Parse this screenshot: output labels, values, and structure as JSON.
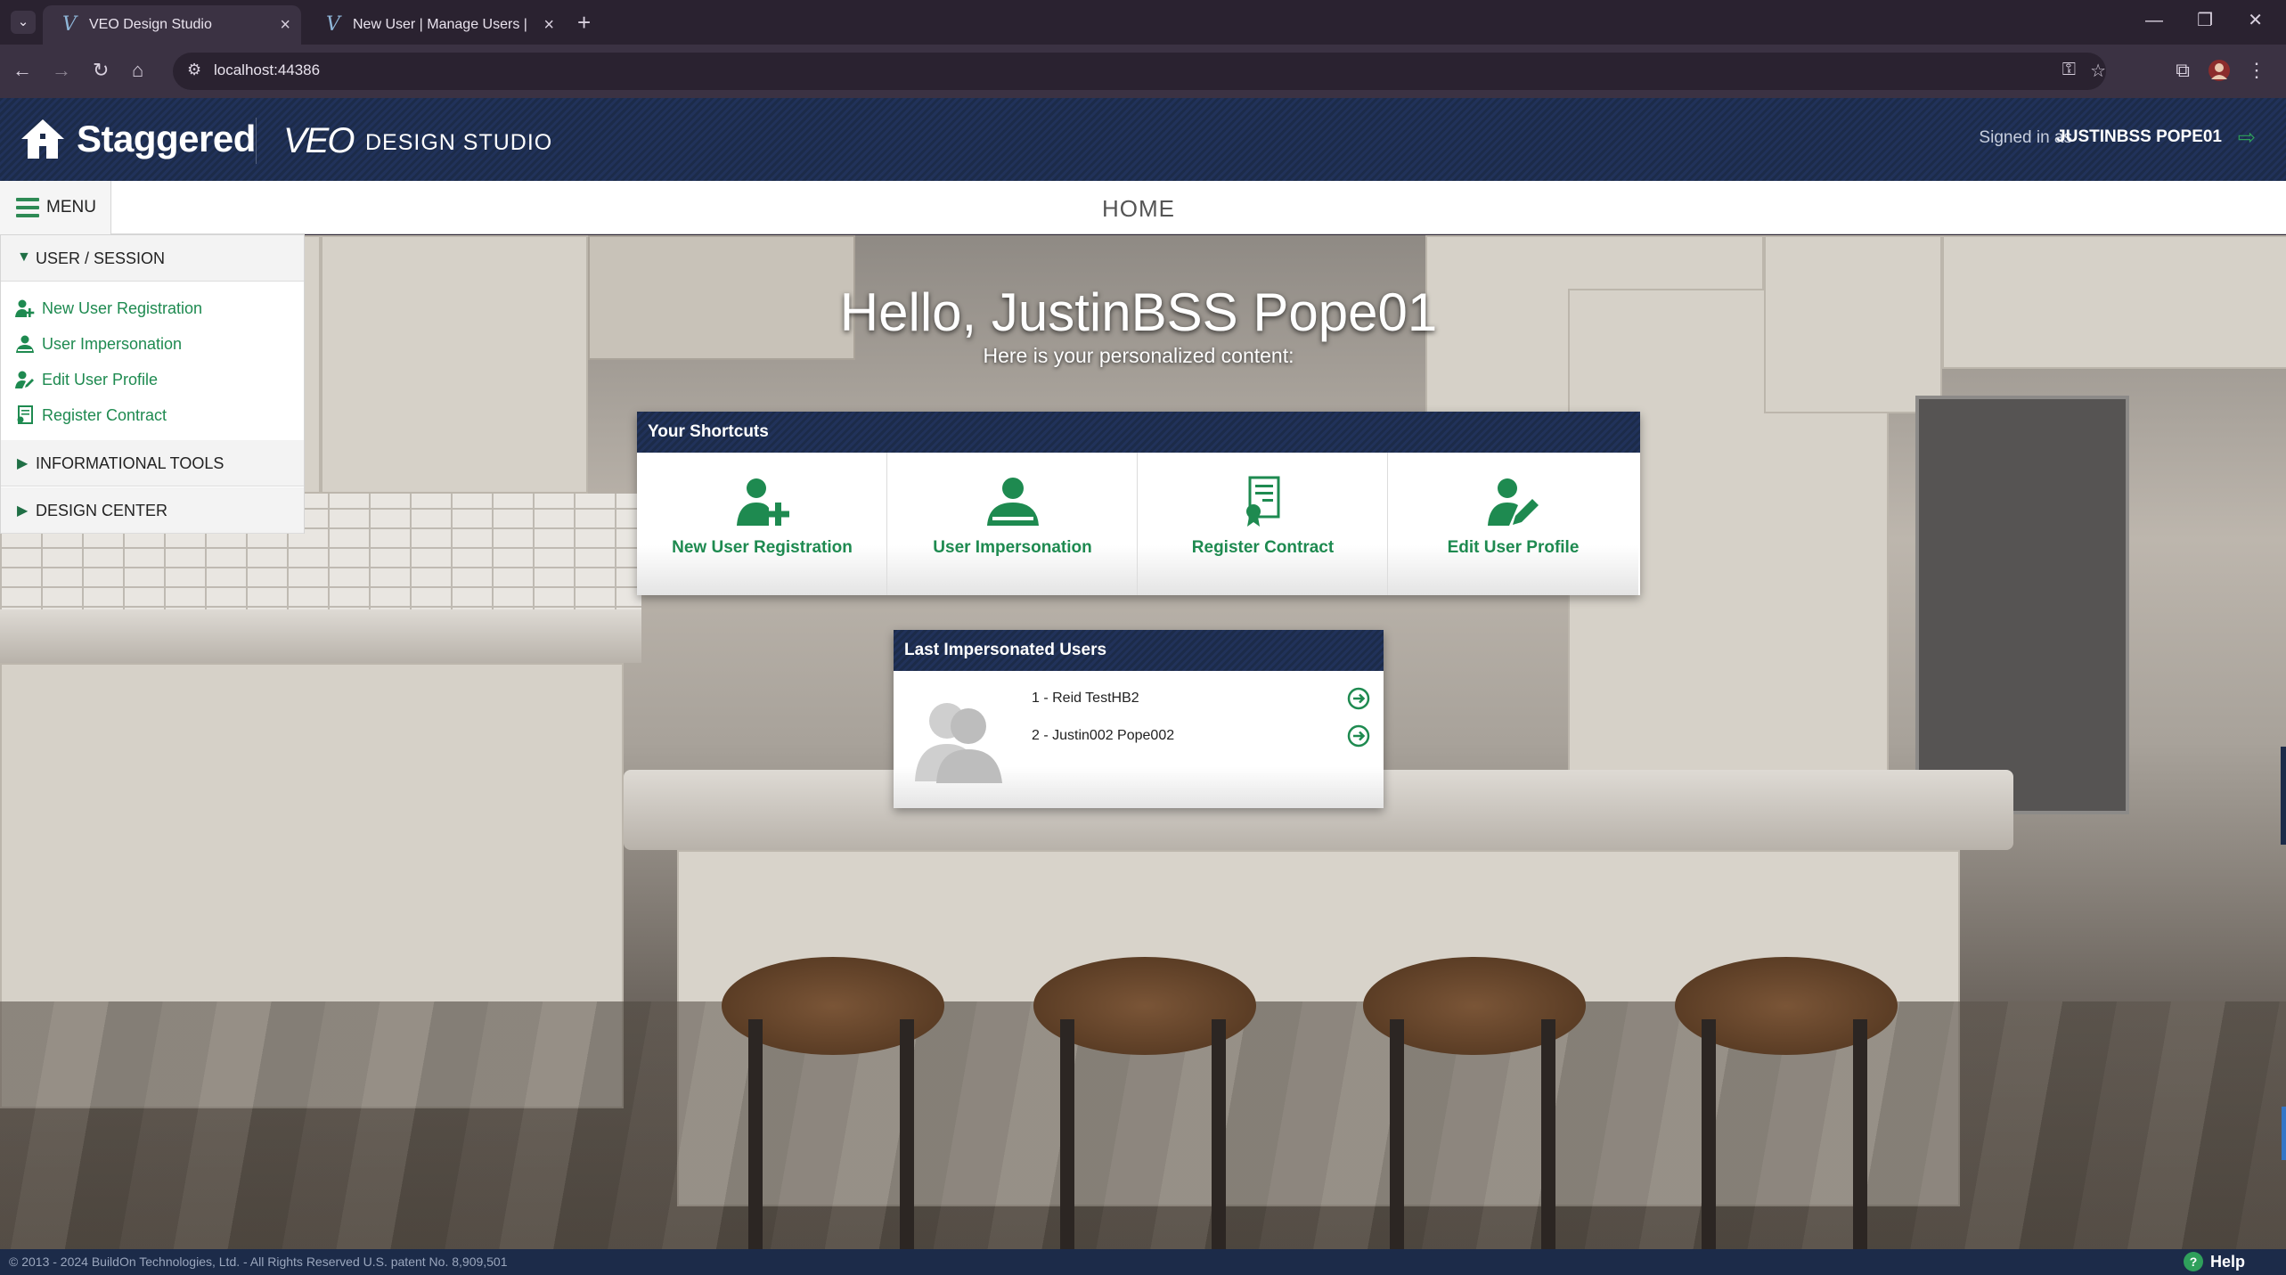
{
  "browser": {
    "tabs": [
      {
        "title": "VEO Design Studio",
        "active": true
      },
      {
        "title": "New User | Manage Users | VEO",
        "active": false
      }
    ],
    "url": "localhost:44386"
  },
  "header": {
    "brand": "Staggered",
    "product_logo": "VEO",
    "product_sub": "DESIGN STUDIO",
    "signed_in_label": "Signed in as",
    "signed_in_user": "JUSTINBSS POPE01"
  },
  "homebar": {
    "menu_label": "MENU",
    "title": "HOME"
  },
  "sidebar": {
    "sections": [
      {
        "label": "USER / SESSION",
        "expanded": true,
        "items": [
          {
            "label": "New User Registration",
            "icon": "add-user-icon"
          },
          {
            "label": "User Impersonation",
            "icon": "user-impersonation-icon"
          },
          {
            "label": "Edit User Profile",
            "icon": "edit-user-icon"
          },
          {
            "label": "Register Contract",
            "icon": "contract-icon"
          }
        ]
      },
      {
        "label": "INFORMATIONAL TOOLS",
        "expanded": false
      },
      {
        "label": "DESIGN CENTER",
        "expanded": false
      }
    ]
  },
  "main": {
    "greeting": "Hello, JustinBSS Pope01",
    "greeting_sub": "Here is your personalized content:"
  },
  "shortcuts": {
    "title": "Your Shortcuts",
    "items": [
      {
        "label": "New User Registration",
        "icon": "add-user-icon"
      },
      {
        "label": "User Impersonation",
        "icon": "user-impersonation-icon"
      },
      {
        "label": "Register Contract",
        "icon": "contract-icon"
      },
      {
        "label": "Edit User Profile",
        "icon": "edit-user-icon"
      }
    ]
  },
  "last_impersonated": {
    "title": "Last Impersonated Users",
    "users": [
      {
        "label": "1 - Reid TestHB2"
      },
      {
        "label": "2 - Justin002 Pope002"
      }
    ]
  },
  "footer": {
    "copyright": "© 2013 - 2024 BuildOn Technologies, Ltd. - All Rights Reserved U.S. patent No. 8,909,501",
    "help_label": "Help"
  },
  "colors": {
    "accent_green": "#1e8a50",
    "header_navy": "#1c2b49"
  }
}
